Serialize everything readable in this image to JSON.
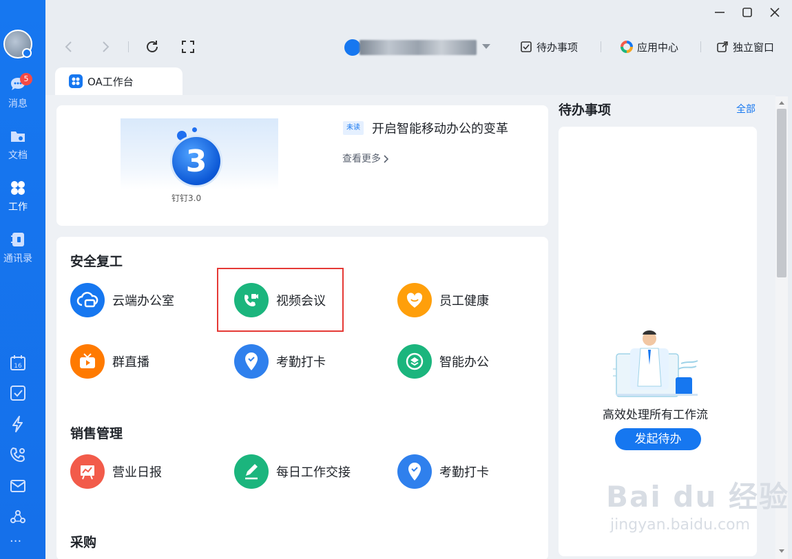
{
  "rail": {
    "badge": "5",
    "items": [
      {
        "label": "消息",
        "icon": "chat-icon"
      },
      {
        "label": "文档",
        "icon": "folder-icon"
      },
      {
        "label": "工作",
        "icon": "grid-icon"
      },
      {
        "label": "通讯录",
        "icon": "contacts-icon"
      }
    ],
    "more": "···"
  },
  "toolbar": {
    "todo": "待办事项",
    "app_center": "应用中心",
    "standalone": "独立窗口"
  },
  "tab": {
    "label": "OA工作台"
  },
  "banner": {
    "caption": "钉钉3.0",
    "digit": "3",
    "unread": "未读",
    "title": "开启智能移动办公的变革",
    "more": "查看更多"
  },
  "sections": [
    {
      "title": "安全复工",
      "apps": [
        "云端办公室",
        "视频会议",
        "员工健康",
        "群直播",
        "考勤打卡",
        "智能办公"
      ]
    },
    {
      "title": "销售管理",
      "apps": [
        "营业日报",
        "每日工作交接",
        "考勤打卡"
      ]
    },
    {
      "title": "采购"
    }
  ],
  "right_panel": {
    "title": "待办事项",
    "all": "全部",
    "desc": "高效处理所有工作流",
    "button": "发起待办"
  },
  "watermark": {
    "brand": "Bai du 经验",
    "url": "jingyan.baidu.com"
  },
  "colors": {
    "primary": "#1677f0",
    "green": "#1bb57d",
    "orange": "#ff8a00",
    "red": "#f25b4a",
    "highlight": "#e53935"
  }
}
